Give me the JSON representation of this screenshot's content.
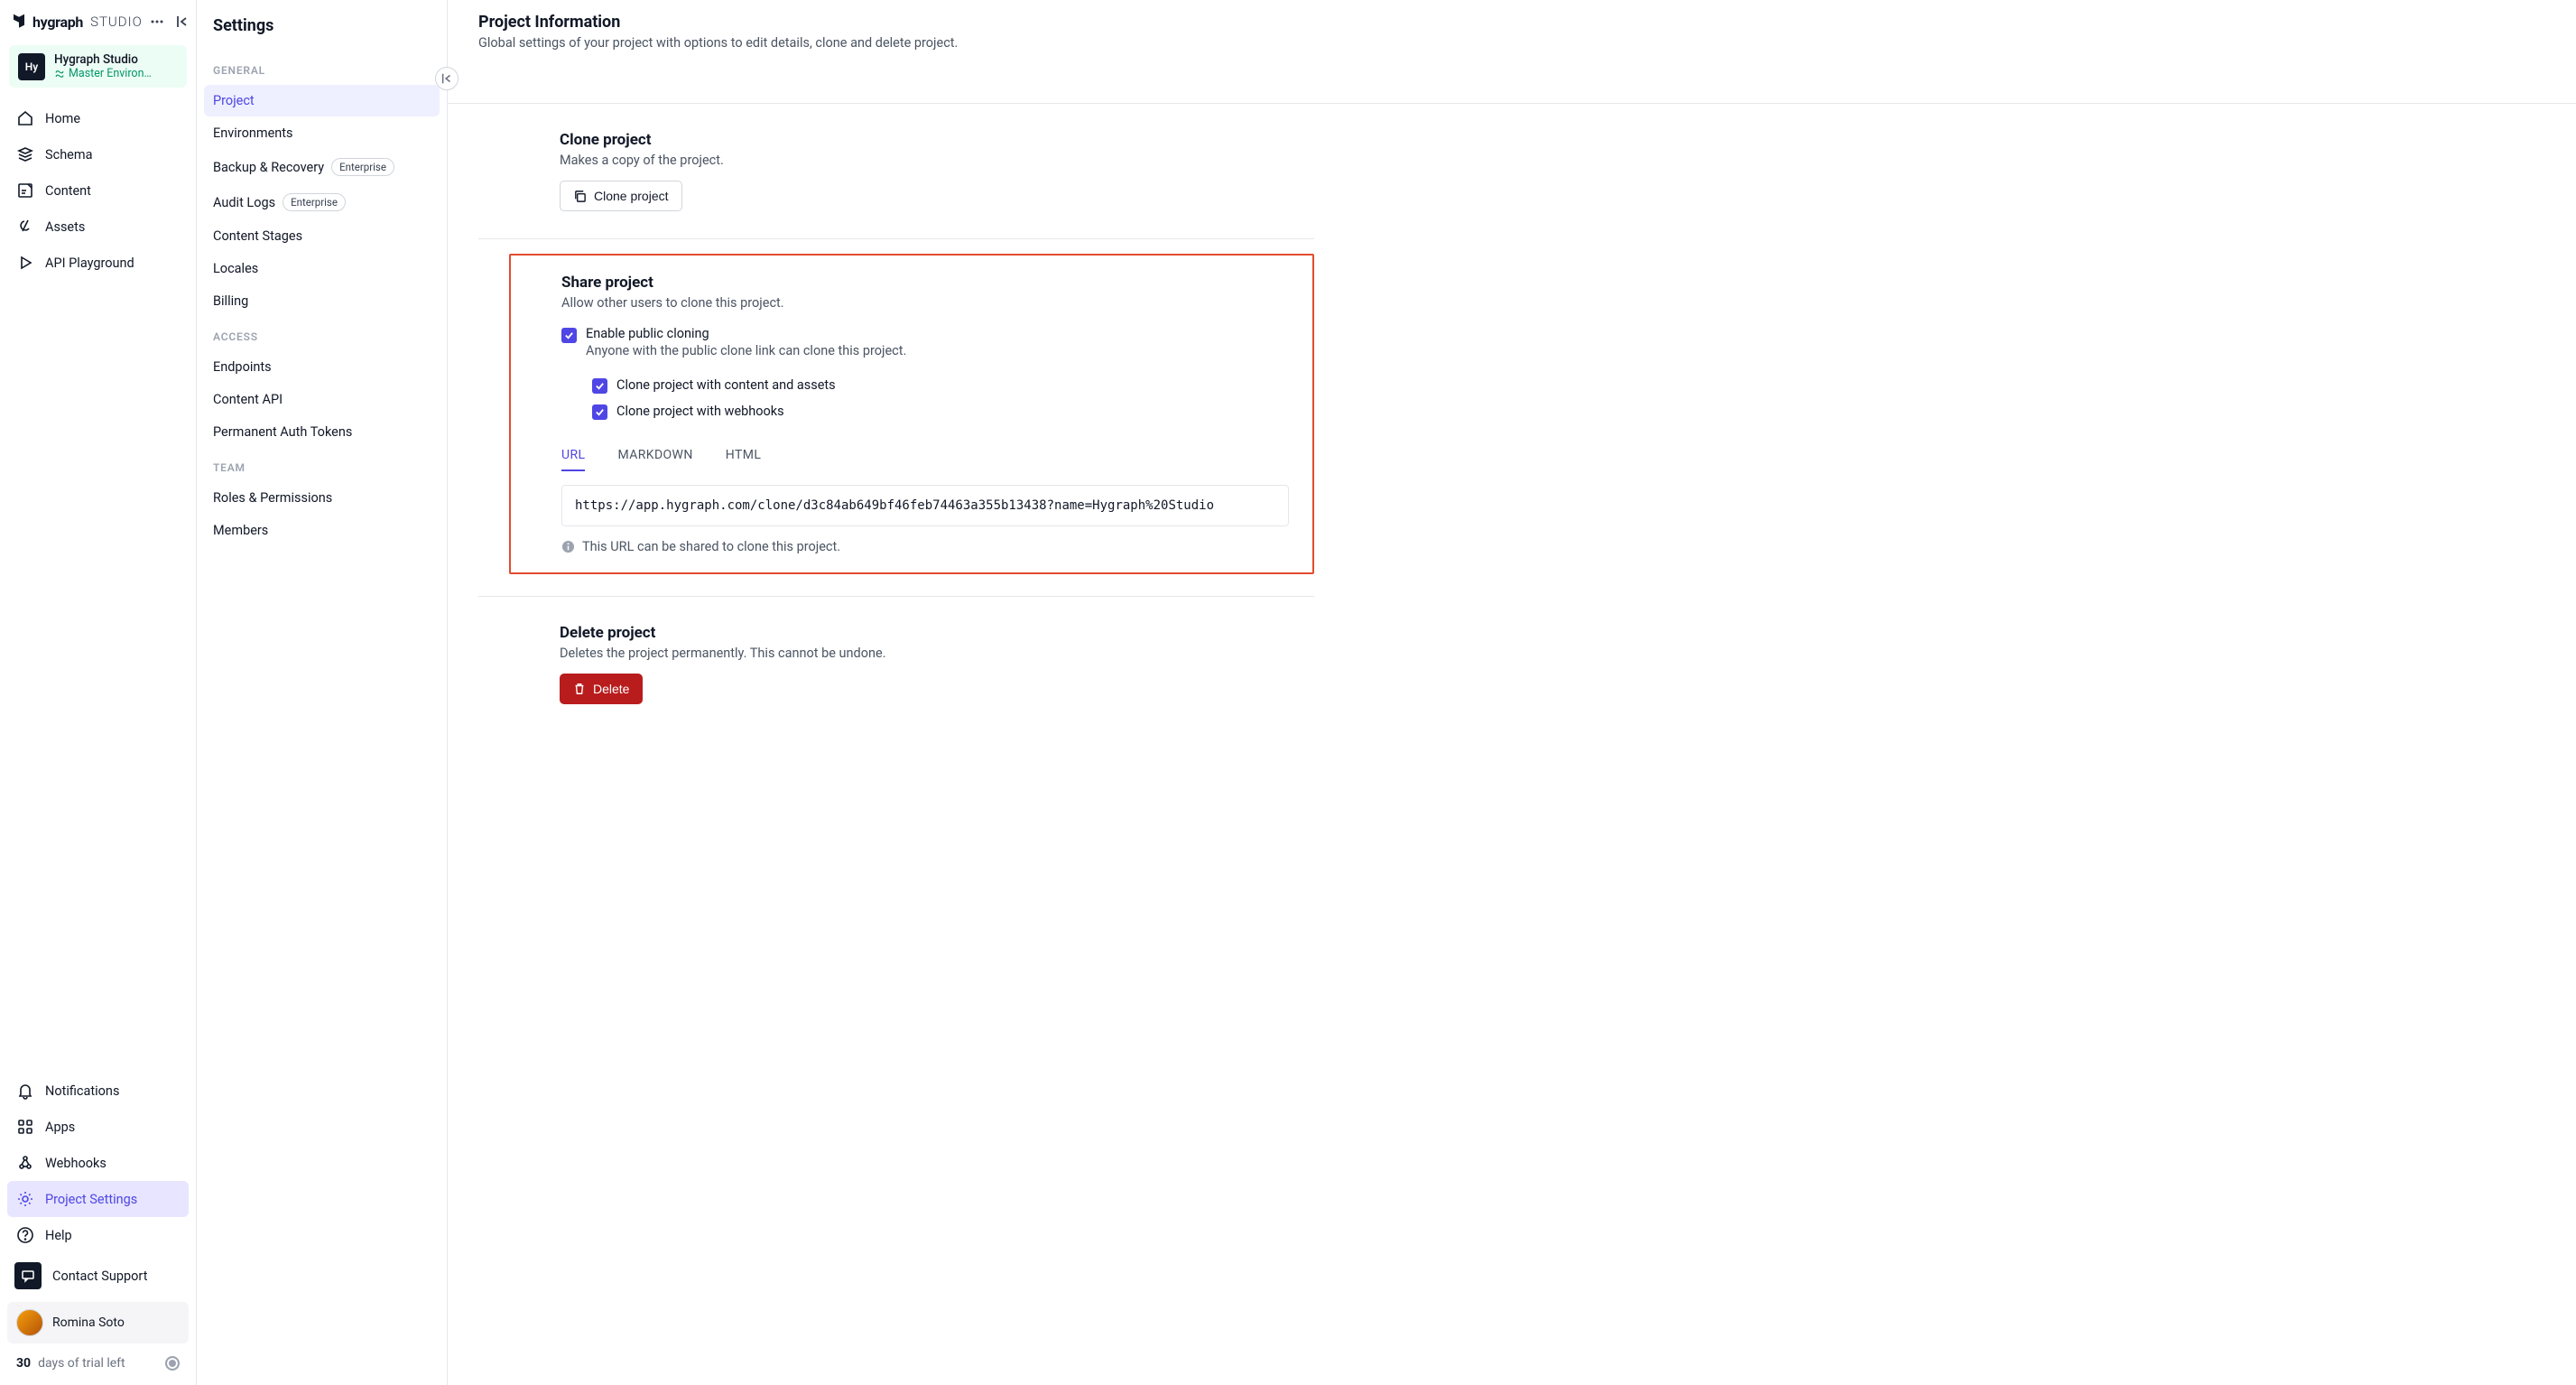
{
  "logo": {
    "brand": "hygraph",
    "suffix": "STUDIO"
  },
  "project_badge": {
    "avatar_text": "Hy",
    "name": "Hygraph Studio",
    "env": "Master Environ…"
  },
  "nav_main": [
    {
      "id": "home",
      "label": "Home"
    },
    {
      "id": "schema",
      "label": "Schema"
    },
    {
      "id": "content",
      "label": "Content"
    },
    {
      "id": "assets",
      "label": "Assets"
    },
    {
      "id": "api-playground",
      "label": "API Playground"
    }
  ],
  "nav_bottom": [
    {
      "id": "notifications",
      "label": "Notifications"
    },
    {
      "id": "apps",
      "label": "Apps"
    },
    {
      "id": "webhooks",
      "label": "Webhooks"
    },
    {
      "id": "project-settings",
      "label": "Project Settings",
      "active": true
    },
    {
      "id": "help",
      "label": "Help"
    }
  ],
  "contact_support_label": "Contact Support",
  "user": {
    "name": "Romina Soto"
  },
  "trial": {
    "days": "30",
    "rest": "days of trial left"
  },
  "settings": {
    "title": "Settings",
    "sections": {
      "general_label": "GENERAL",
      "access_label": "ACCESS",
      "team_label": "TEAM",
      "general": [
        {
          "label": "Project",
          "active": true
        },
        {
          "label": "Environments"
        },
        {
          "label": "Backup & Recovery",
          "badge": "Enterprise"
        },
        {
          "label": "Audit Logs",
          "badge": "Enterprise"
        },
        {
          "label": "Content Stages"
        },
        {
          "label": "Locales"
        },
        {
          "label": "Billing"
        }
      ],
      "access": [
        {
          "label": "Endpoints"
        },
        {
          "label": "Content API"
        },
        {
          "label": "Permanent Auth Tokens"
        }
      ],
      "team": [
        {
          "label": "Roles & Permissions"
        },
        {
          "label": "Members"
        }
      ]
    }
  },
  "page": {
    "title": "Project Information",
    "subtitle": "Global settings of your project with options to edit details, clone and delete project."
  },
  "clone": {
    "title": "Clone project",
    "subtitle": "Makes a copy of the project.",
    "button": "Clone project"
  },
  "share": {
    "title": "Share project",
    "subtitle": "Allow other users to clone this project.",
    "enable_label": "Enable public cloning",
    "enable_desc": "Anyone with the public clone link can clone this project.",
    "opt_content": "Clone project with content and assets",
    "opt_webhooks": "Clone project with webhooks",
    "tabs": {
      "url": "URL",
      "markdown": "MARKDOWN",
      "html": "HTML"
    },
    "url_value": "https://app.hygraph.com/clone/d3c84ab649bf46feb74463a355b13438?name=Hygraph%20Studio",
    "info": "This URL can be shared to clone this project."
  },
  "delete": {
    "title": "Delete project",
    "subtitle": "Deletes the project permanently. This cannot be undone.",
    "button": "Delete"
  }
}
